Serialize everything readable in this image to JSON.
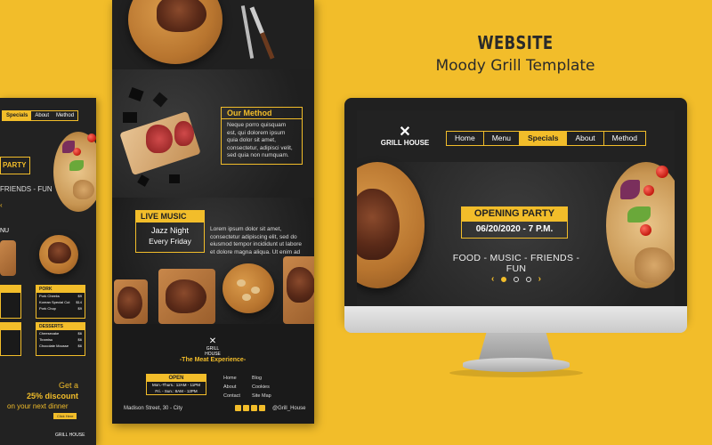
{
  "header": {
    "title": "WEBSITE",
    "subtitle": "Moody Grill Template"
  },
  "mobile": {
    "nav": [
      "Specials",
      "About",
      "Method"
    ],
    "party_label": "PARTY",
    "tagline": "FRIENDS - FUN",
    "arrow": "‹",
    "menu_label": "NU",
    "boxes": [
      {
        "title": "PORK",
        "rows": [
          [
            "Pork Cheeks",
            "$9"
          ],
          [
            "Korean Special Cut",
            "$14"
          ],
          [
            "Pork Chop",
            "$9"
          ]
        ]
      },
      {
        "title": "DESSERTS",
        "rows": [
          [
            "Cheesecake",
            "$6"
          ],
          [
            "Tiramisu",
            "$6"
          ],
          [
            "Chocolate Mousse",
            "$6"
          ]
        ]
      }
    ],
    "discount_get": "Get a",
    "discount_pct": "25% discount",
    "discount_next": "on your next dinner",
    "click_label": "Click Here",
    "logo_text": "GRILL HOUSE"
  },
  "longpage": {
    "method_title": "Our Method",
    "method_body": "Neque porro quisquam est, qui dolorem ipsum quia dolor sit amet, consectetur, adipisci velit, sed quia non numquam.",
    "live_title": "LIVE MUSIC",
    "live_jazz": "Jazz Night",
    "live_day": "Every Friday",
    "live_body": "Lorem ipsum dolor sit amet, consectetur adipiscing elit, sed do eiusmod tempor incididunt ut labore et dolore magna aliqua. Ut enim ad minim veniam, quis nostrud exercitation ullamco laboris nisi ut aliquip ex ea commodo consequat. Duis aute irure dolor in reprehenderit in voluptate velit esse cillum dolore eu fugiat nulla pariatur. Excepteur sint occaecat cupidatat non proident, sunt in culpa qui officia deserunt mollit anim id est laborum.",
    "logo_text": "GRILL HOUSE",
    "experience": "-The Meat Experience-",
    "open_title": "OPEN",
    "open_line1": "Mon.-Thurs.: 12AM - 11PM",
    "open_line2": "Fri. - Sun.: 8AM - 12PM",
    "links_col1": [
      "Home",
      "About",
      "Contact"
    ],
    "links_col2": [
      "Blog",
      "Cookies",
      "Site Map"
    ],
    "address": "Madison Street, 30 - City",
    "handle": "@Grill_House"
  },
  "desktop": {
    "logo_text": "GRILL HOUSE",
    "nav": [
      "Home",
      "Menu",
      "Specials",
      "About",
      "Method"
    ],
    "active_nav": "Specials",
    "party_title": "OPENING PARTY",
    "party_date": "06/20/2020 - 7 P.M.",
    "tagline": "FOOD - MUSIC - FRIENDS - FUN",
    "slider_prev": "‹",
    "slider_next": "›",
    "slide_count": 4,
    "active_slide": 1
  },
  "colors": {
    "background": "#f2bd2a",
    "accent": "#f2bd2a",
    "dark": "#1e1e1e"
  }
}
